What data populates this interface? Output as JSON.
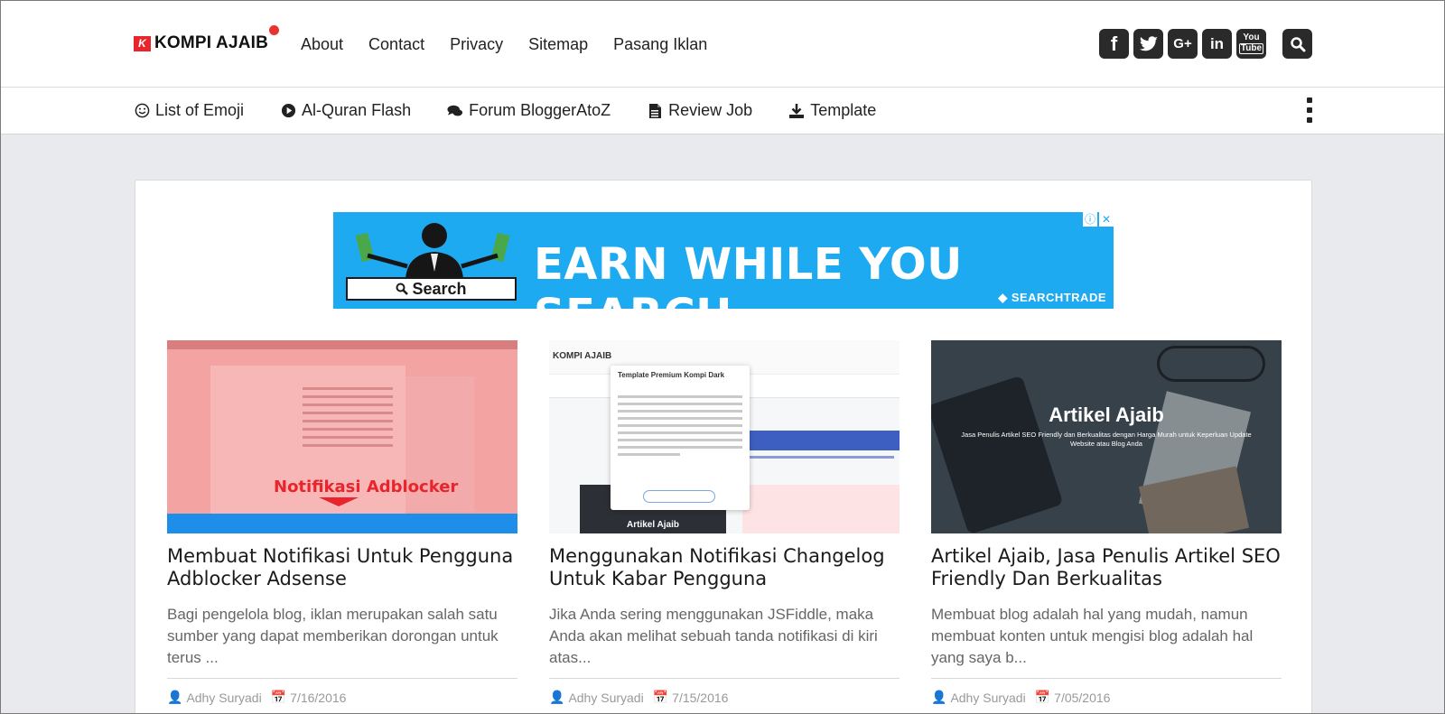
{
  "header": {
    "logo_mark": "K",
    "logo_text": "KOMPI AJAIB",
    "nav": [
      "About",
      "Contact",
      "Privacy",
      "Sitemap",
      "Pasang Iklan"
    ],
    "social": [
      {
        "icon": "facebook-icon",
        "glyph": "f"
      },
      {
        "icon": "twitter-icon",
        "glyph": "t"
      },
      {
        "icon": "google-plus-icon",
        "glyph": "G+"
      },
      {
        "icon": "linkedin-icon",
        "glyph": "in"
      },
      {
        "icon": "youtube-icon",
        "glyph": "You\nTube"
      }
    ]
  },
  "subnav": {
    "items": [
      {
        "label": "List of Emoji",
        "icon": "smile-icon"
      },
      {
        "label": "Al-Quran Flash",
        "icon": "play-icon"
      },
      {
        "label": "Forum BloggerAtoZ",
        "icon": "comments-icon"
      },
      {
        "label": "Review Job",
        "icon": "document-icon"
      },
      {
        "label": "Template",
        "icon": "download-icon"
      }
    ]
  },
  "ad": {
    "headline": "EARN WHILE YOU SEARCH",
    "search_label": "Search",
    "brand": "SEARCHTRADE",
    "colors": {
      "background": "#1eaaf1"
    }
  },
  "thumbs": {
    "t1_notif": "Notifikasi Adblocker",
    "t2_popup_title": "Template Premium Kompi Dark",
    "t2_dark_label": "Artikel Ajaib",
    "t2_logo": "KOMPI AJAIB",
    "t3_title": "Artikel Ajaib",
    "t3_sub": "Jasa Penulis Artikel SEO Friendly dan Berkualitas dengan Harga Murah untuk Keperluan Update Website atau Blog Anda"
  },
  "posts": [
    {
      "title": "Membuat Notifikasi Untuk Pengguna Adblocker Adsense",
      "excerpt": "Bagi pengelola blog, iklan merupakan salah satu sumber yang dapat memberikan dorongan untuk terus ...",
      "author": "Adhy Suryadi",
      "date": "7/16/2016"
    },
    {
      "title": "Menggunakan Notifikasi Changelog Untuk Kabar Pengguna",
      "excerpt": "Jika Anda sering menggunakan JSFiddle, maka Anda akan melihat sebuah tanda notifikasi di kiri atas...",
      "author": "Adhy Suryadi",
      "date": "7/15/2016"
    },
    {
      "title": "Artikel Ajaib, Jasa Penulis Artikel SEO Friendly Dan Berkualitas",
      "excerpt": "Membuat blog adalah hal yang mudah, namun membuat konten untuk mengisi blog adalah hal yang saya b...",
      "author": "Adhy Suryadi",
      "date": "7/05/2016"
    }
  ],
  "colors": {
    "brand_red": "#e8242d",
    "page_bg": "#e8eaed"
  }
}
